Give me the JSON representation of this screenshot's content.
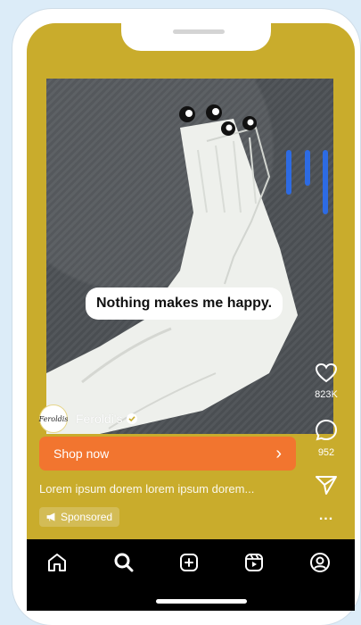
{
  "post": {
    "caption_text": "Nothing makes me happy.",
    "account_name": "Feroldi's",
    "avatar_text": "Feroldis",
    "shop_button_label": "Shop now",
    "shop_button_arrow": "›",
    "description": "Lorem ipsum dorem lorem ipsum dorem...",
    "sponsored_label": "Sponsored"
  },
  "actions": {
    "like_count": "823K",
    "comment_count": "952",
    "more_label": "..."
  },
  "icons": {
    "like": "heart-icon",
    "comment": "comment-icon",
    "share": "send-icon",
    "more": "more-icon",
    "verified": "verified-badge-icon",
    "sponsored": "megaphone-icon",
    "nav": [
      "home-icon",
      "search-icon",
      "create-icon",
      "reels-icon",
      "profile-icon"
    ]
  },
  "colors": {
    "background": "#c9ac2c",
    "shop_button": "#f2752f",
    "accent_strokes": "#2d6be3",
    "navbar": "#000000"
  }
}
